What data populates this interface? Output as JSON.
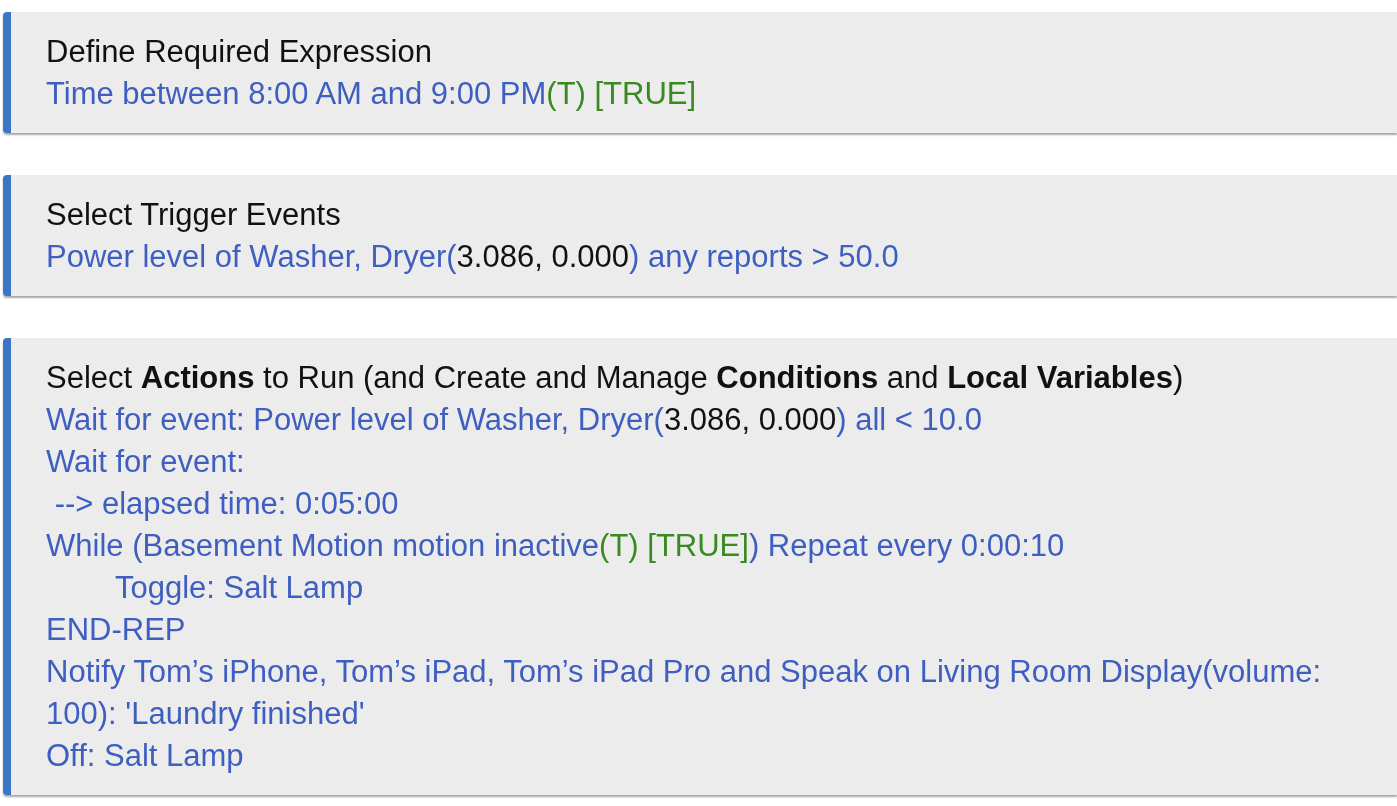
{
  "sections": [
    {
      "title": "Define Required Expression",
      "lines": [
        {
          "segments": [
            {
              "kind": "text",
              "text": "Time between 8:00 AM and 9:00 PM"
            },
            {
              "kind": "truth",
              "text": "(T) [TRUE]"
            }
          ]
        }
      ]
    },
    {
      "title": "Select Trigger Events",
      "lines": [
        {
          "segments": [
            {
              "kind": "text",
              "text": "Power level of Washer, Dryer("
            },
            {
              "kind": "value",
              "text": "3.086, 0.000"
            },
            {
              "kind": "text",
              "text": ") any reports > 50.0"
            }
          ]
        }
      ]
    },
    {
      "title": "Select **Actions** to Run (and Create and Manage **Conditions** and **Local Variables**)",
      "lines": [
        {
          "segments": [
            {
              "kind": "text",
              "text": "Wait for event: Power level of Washer, Dryer("
            },
            {
              "kind": "value",
              "text": "3.086, 0.000"
            },
            {
              "kind": "text",
              "text": ") all < 10.0"
            }
          ]
        },
        {
          "segments": [
            {
              "kind": "text",
              "text": "Wait for event:"
            }
          ]
        },
        {
          "segments": [
            {
              "kind": "text",
              "text": " --> elapsed time: 0:05:00"
            }
          ]
        },
        {
          "segments": [
            {
              "kind": "text",
              "text": "While (Basement Motion motion inactive"
            },
            {
              "kind": "truth",
              "text": "(T) [TRUE]"
            },
            {
              "kind": "text",
              "text": ") Repeat every 0:00:10"
            }
          ],
          "children": [
            {
              "segments": [
                {
                  "kind": "text",
                  "text": "Toggle: Salt Lamp"
                }
              ]
            }
          ]
        },
        {
          "segments": [
            {
              "kind": "text",
              "text": "END-REP"
            }
          ]
        },
        {
          "segments": [
            {
              "kind": "text",
              "text": "Notify Tom’s iPhone, Tom’s iPad, Tom’s iPad Pro and Speak on Living Room Display(volume: 100): 'Laundry finished'"
            }
          ]
        },
        {
          "segments": [
            {
              "kind": "text",
              "text": "Off: Salt Lamp"
            }
          ]
        }
      ]
    }
  ]
}
